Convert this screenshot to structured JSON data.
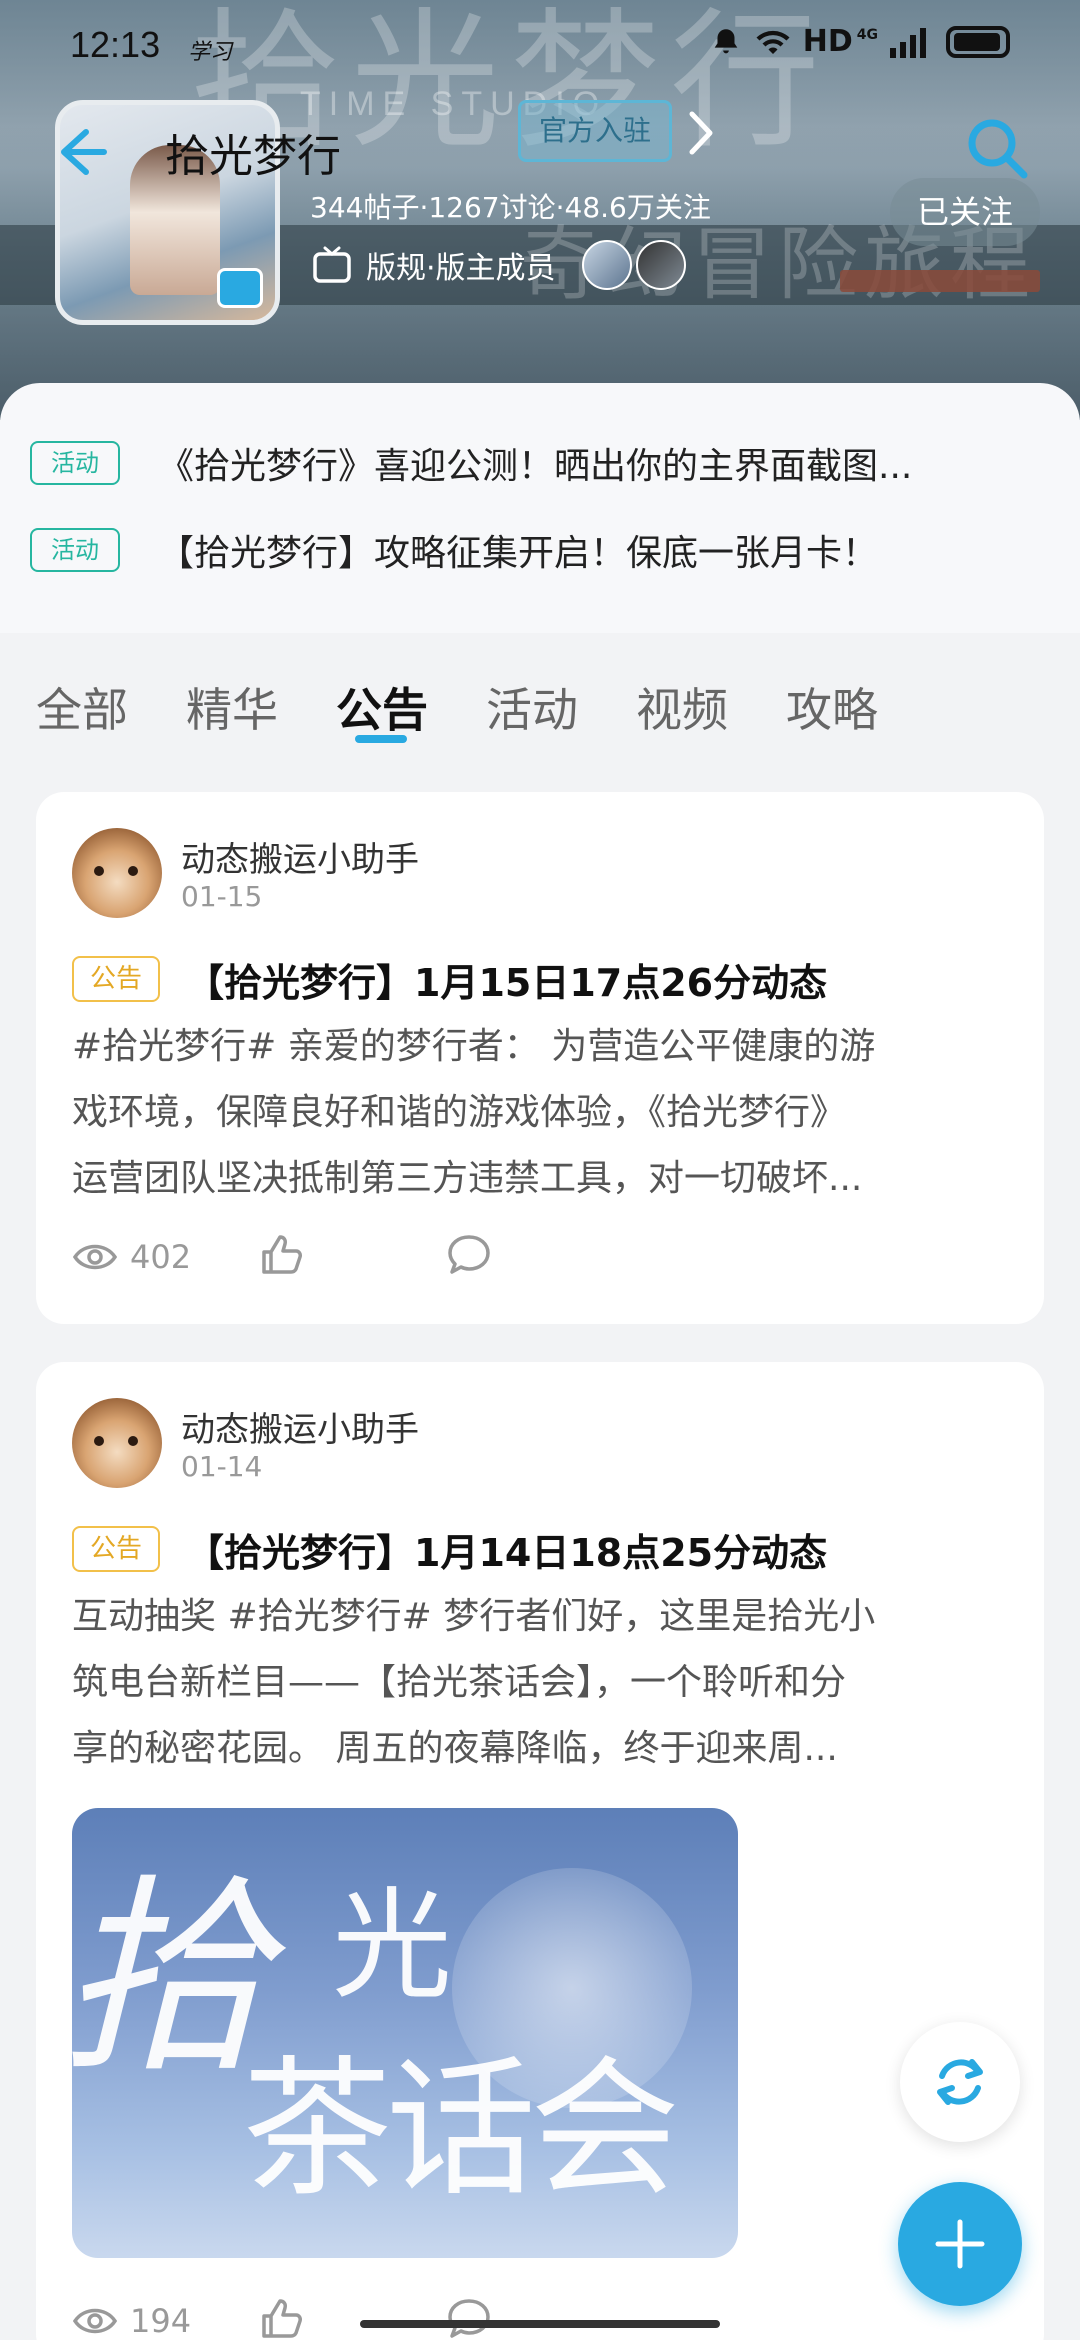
{
  "status_bar": {
    "time": "12:13",
    "extra": "学习",
    "network": "HD",
    "signal": "4G"
  },
  "header": {
    "title": "拾光梦行",
    "official_label": "官方入驻",
    "stats": "344帖子·1267讨论·48.6万关注",
    "rules_label": "版规·版主成员",
    "follow_label": "已关注",
    "banner_watermark": "拾光梦行",
    "banner_subtitle": "TIME STUDIO",
    "banner_slogan": "奇幻冒险旅程"
  },
  "notices": [
    {
      "tag": "活动",
      "text": "《拾光梦行》喜迎公测！晒出你的主界面截图..."
    },
    {
      "tag": "活动",
      "text": "【拾光梦行】攻略征集开启！保底一张月卡！"
    }
  ],
  "tabs": [
    {
      "label": "全部"
    },
    {
      "label": "精华"
    },
    {
      "label": "公告"
    },
    {
      "label": "活动"
    },
    {
      "label": "视频"
    },
    {
      "label": "攻略"
    }
  ],
  "active_tab": "公告",
  "posts": [
    {
      "author": "动态搬运小助手",
      "date": "01-15",
      "tag": "公告",
      "title": "【拾光梦行】1月15日17点26分动态",
      "body": [
        "#拾光梦行# 亲爱的梦行者：   为营造公平健康的游",
        "戏环境，保障良好和谐的游戏体验，《拾光梦行》",
        "运营团队坚决抵制第三方违禁工具，对一切破坏..."
      ],
      "views": "402"
    },
    {
      "author": "动态搬运小助手",
      "date": "01-14",
      "tag": "公告",
      "title": "【拾光梦行】1月14日18点25分动态",
      "body": [
        "互动抽奖 #拾光梦行#  梦行者们好，这里是拾光小",
        "筑电台新栏目——【拾光茶话会】，一个聆听和分",
        "享的秘密花园。 周五的夜幕降临，终于迎来周..."
      ],
      "image_text": {
        "line1": "拾",
        "line2": "光",
        "line3": "茶话会"
      },
      "views": "194"
    }
  ],
  "colors": {
    "accent": "#29a9e1",
    "activity_tag": "#26b6a0",
    "notice_tag": "#e4a824"
  }
}
